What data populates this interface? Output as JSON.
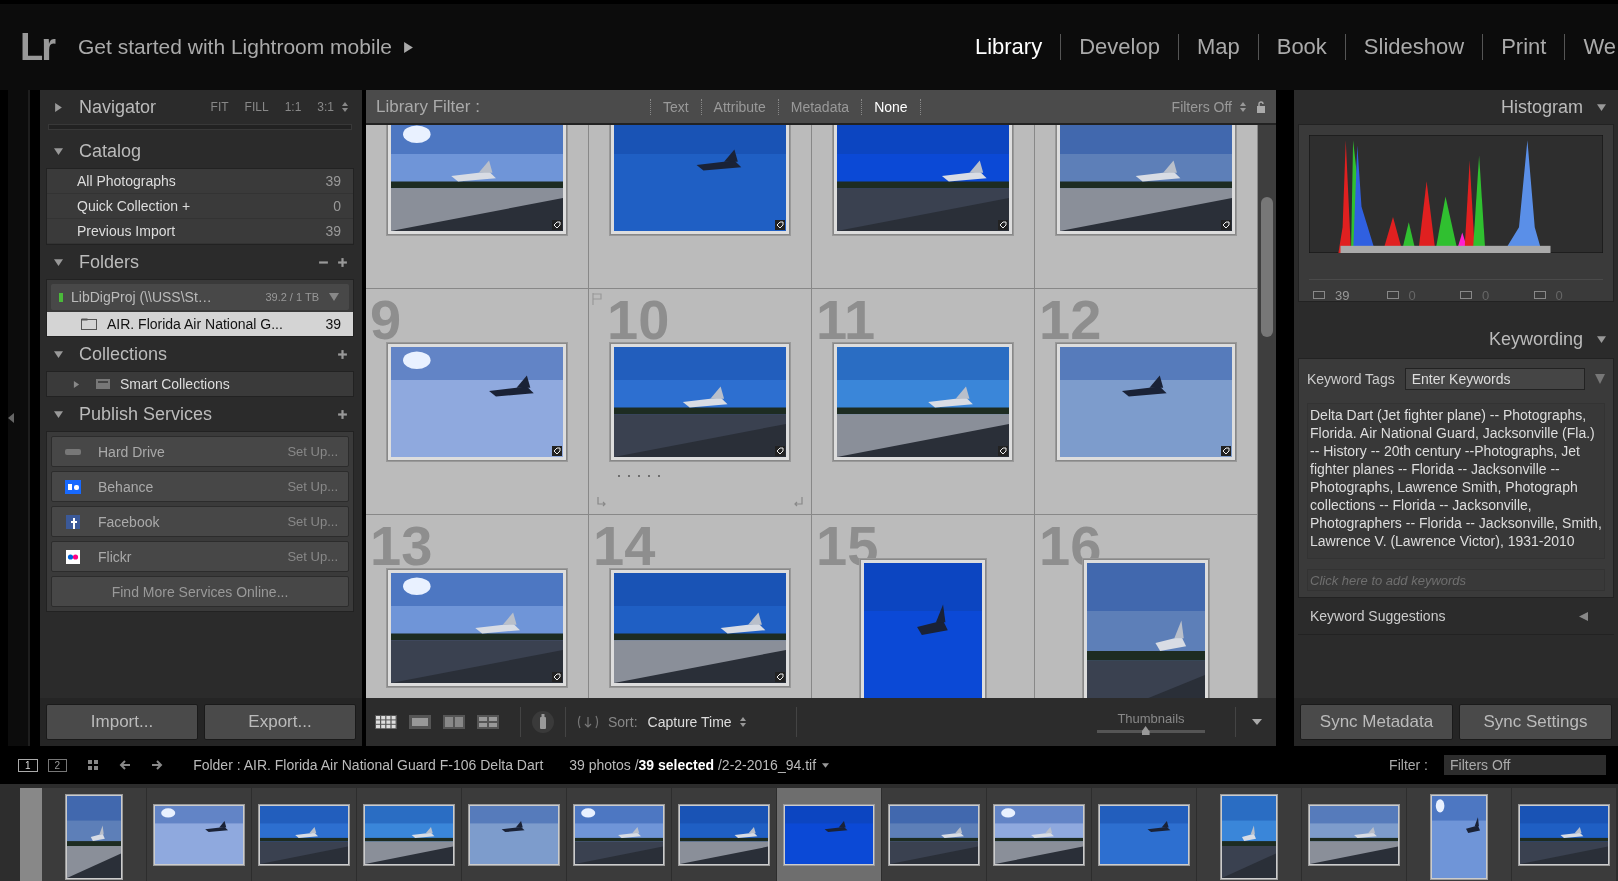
{
  "top_bar": {
    "logo": "Lr",
    "mobile_prompt": "Get started with Lightroom mobile",
    "modules": [
      {
        "label": "Library",
        "selected": true
      },
      {
        "label": "Develop",
        "selected": false
      },
      {
        "label": "Map",
        "selected": false
      },
      {
        "label": "Book",
        "selected": false
      },
      {
        "label": "Slideshow",
        "selected": false
      },
      {
        "label": "Print",
        "selected": false
      },
      {
        "label": "We",
        "selected": false
      }
    ]
  },
  "left_panel": {
    "navigator": {
      "title": "Navigator",
      "zoom_options": [
        "FIT",
        "FILL",
        "1:1",
        "3:1"
      ]
    },
    "catalog": {
      "title": "Catalog",
      "items": [
        {
          "label": "All Photographs",
          "count": "39"
        },
        {
          "label": "Quick Collection  +",
          "count": "0"
        },
        {
          "label": "Previous Import",
          "count": "39"
        }
      ]
    },
    "folders": {
      "title": "Folders",
      "volume": {
        "name": "LibDigProj  (\\\\USS\\St…",
        "size": "39.2 / 1 TB"
      },
      "items": [
        {
          "label": "AIR. Florida Air National G...",
          "count": "39",
          "selected": true
        }
      ]
    },
    "collections": {
      "title": "Collections",
      "items": [
        {
          "label": "Smart Collections"
        }
      ]
    },
    "publish_services": {
      "title": "Publish Services",
      "items": [
        {
          "kind": "drive",
          "name": "Hard Drive",
          "action": "Set Up..."
        },
        {
          "kind": "behance",
          "name": "Behance",
          "action": "Set Up..."
        },
        {
          "kind": "facebook",
          "name": "Facebook",
          "action": "Set Up..."
        },
        {
          "kind": "flickr",
          "name": "Flickr",
          "action": "Set Up..."
        }
      ],
      "find_more": "Find More Services Online..."
    },
    "buttons": [
      "Import...",
      "Export..."
    ]
  },
  "library_filter": {
    "title": "Library Filter :",
    "options": [
      {
        "label": "Text",
        "selected": false
      },
      {
        "label": "Attribute",
        "selected": false
      },
      {
        "label": "Metadata",
        "selected": false
      },
      {
        "label": "None",
        "selected": true
      }
    ],
    "preset": "Filters Off"
  },
  "grid": {
    "cells": [
      {
        "hover": false
      },
      {
        "hover": false
      },
      {
        "hover": false
      },
      {
        "hover": false
      },
      {
        "number": "9",
        "hover": false
      },
      {
        "number": "10",
        "hover": true
      },
      {
        "number": "11",
        "hover": false
      },
      {
        "number": "12",
        "hover": false
      },
      {
        "number": "13",
        "hover": false
      },
      {
        "number": "14",
        "hover": false
      },
      {
        "number": "15",
        "hover": false
      },
      {
        "number": "16",
        "hover": false
      }
    ]
  },
  "toolbar": {
    "sort_label": "Sort:",
    "sort_value": "Capture Time",
    "thumbnails_label": "Thumbnails",
    "level": 0.45
  },
  "right_panel": {
    "histogram": {
      "title": "Histogram",
      "counts": [
        "39",
        "0",
        "0",
        "0"
      ]
    },
    "keywording": {
      "title": "Keywording",
      "tags_label": "Keyword Tags",
      "tags_value": "Enter Keywords",
      "keywords": "Delta Dart (Jet fighter plane) -- Photographs, Florida. Air National Guard, Jacksonville (Fla.) -- History -- 20th century --Photographs, Jet fighter planes -- Florida -- Jacksonville -- Photographs, Lawrence Smith, Photograph collections -- Florida -- Jacksonville, Photographers -- Florida -- Jacksonville, Smith, Lawrence V. (Lawrence Victor), 1931-2010",
      "placeholder": "Click here to add keywords",
      "suggestions": "Keyword Suggestions"
    },
    "buttons": [
      "Sync Metadata",
      "Sync Settings"
    ]
  },
  "status_bar": {
    "pages": [
      {
        "label": "1",
        "selected": true
      },
      {
        "label": "2",
        "selected": false
      }
    ],
    "folder": "Folder : AIR. Florida Air National Guard F-106 Delta Dart",
    "selection": "39 photos /**39 selected** /2-2-2016_94.tif",
    "filter_label": "Filter :",
    "filter_value": "Filters Off"
  },
  "filmstrip": [
    {
      "selected": false
    },
    {
      "selected": false
    },
    {
      "selected": false
    },
    {
      "selected": false
    },
    {
      "selected": false
    },
    {
      "selected": false
    },
    {
      "selected": false
    },
    {
      "selected": true
    },
    {
      "selected": false
    },
    {
      "selected": false
    },
    {
      "selected": false
    },
    {
      "selected": false
    },
    {
      "selected": false
    },
    {
      "selected": false
    },
    {
      "selected": false
    }
  ]
}
